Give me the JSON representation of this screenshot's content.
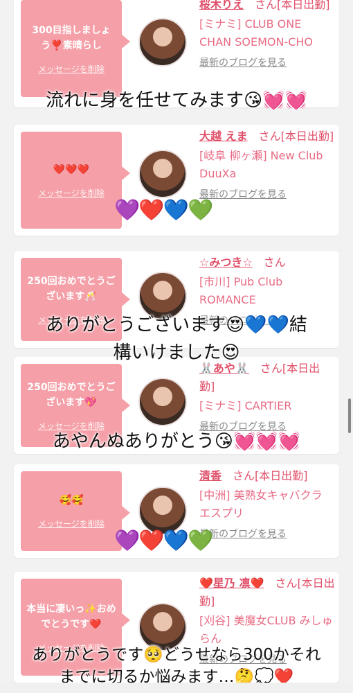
{
  "cards": [
    {
      "bubble_message": "300目指しましょう❣️素晴らし",
      "delete_label": "メッセージを削除",
      "name": "桜木りえ",
      "suffix": "さん[本日出勤]",
      "store": "[ミナミ] CLUB ONE CHAN SOEMON-CHO",
      "blog_link": "最新のブログを見る"
    },
    {
      "bubble_message": "❤️❤️❤️",
      "delete_label": "メッセージを削除",
      "name": "大越 えま",
      "suffix": "さん[本日出勤]",
      "store": "[岐阜 柳ヶ瀬] New Club DuuXa",
      "blog_link": "最新のブログを見る"
    },
    {
      "bubble_message": "250回おめでとうございます🥂",
      "delete_label": "メッセージを削除",
      "name": "☆みつき☆",
      "suffix": "さん",
      "store": "[市川] Pub Club ROMANCE",
      "blog_link": "最新のブログを見る"
    },
    {
      "bubble_message": "250回おめでとうございます💖",
      "delete_label": "メッセージを削除",
      "name": "🐰あや🐰",
      "suffix": "さん[本日出勤]",
      "store": "[ミナミ] CARTIER",
      "blog_link": "最新のブログを見る"
    },
    {
      "bubble_message": "🥰🥰",
      "delete_label": "メッセージを削除",
      "name": "清香",
      "suffix": "さん[本日出勤]",
      "store": "[中洲] 美熟女キャバクラ エスプリ",
      "blog_link": "最新のブログを見る"
    },
    {
      "bubble_message": "本当に凄いっ✨おめでとうです❤️",
      "delete_label": "メッセージを削除",
      "name": "❤️星乃 凛❤️",
      "suffix": "さん[本日出勤]",
      "store": "[刈谷] 美魔女CLUB みしゅらん",
      "blog_link": "最新のブログを見る"
    }
  ],
  "overlays": {
    "line1": "流れに身を任せてみます😘💓💓",
    "hearts1": "💜❤️💙💚",
    "line2a": "ありがとうございます😍💙💙結",
    "line2b": "構いけました😍",
    "line3": "あやんぬありがとう😘💓💓💓",
    "hearts2": "💜❤️💙💚",
    "line4a": "ありがとうです🥺どうせなら300かそれ",
    "line4b": "までに切るか悩みます…🤔💭❤️"
  }
}
